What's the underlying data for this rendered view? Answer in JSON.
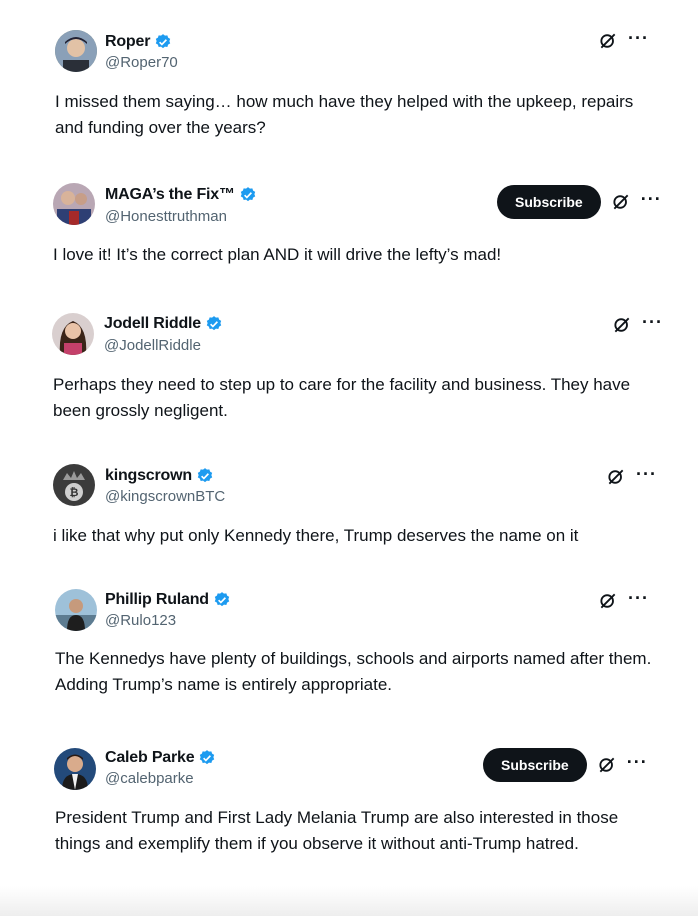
{
  "posts": [
    {
      "name": "Roper",
      "handle": "@Roper70",
      "text": "I missed them saying… how much have they helped with the upkeep, repairs and funding over the years?",
      "subscribe": null
    },
    {
      "name": "MAGA’s the Fix™",
      "handle": "@Honesttruthman",
      "text": "I love it!  It’s the correct plan AND it will drive the lefty’s mad!",
      "subscribe": "Subscribe"
    },
    {
      "name": "Jodell Riddle",
      "handle": "@JodellRiddle",
      "text": "Perhaps they need to step up to care for the facility and business. They have been grossly negligent.",
      "subscribe": null
    },
    {
      "name": "kingscrown",
      "handle": "@kingscrownBTC",
      "text": "i like that why put only Kennedy there, Trump deserves the name on it",
      "subscribe": null
    },
    {
      "name": "Phillip Ruland",
      "handle": "@Rulo123",
      "text": "The Kennedys have plenty of buildings, schools and airports named after them. Adding Trump’s name is entirely appropriate.",
      "subscribe": null
    },
    {
      "name": "Caleb Parke",
      "handle": "@calebparke",
      "text": "President Trump and First Lady Melania Trump are also interested in those things and exemplify them if you observe it without anti-Trump hatred.",
      "subscribe": "Subscribe"
    }
  ],
  "icons": {
    "verified": "verified-badge-icon",
    "grok": "grok-icon",
    "more": "more-icon"
  },
  "colors": {
    "verified": "#1d9bf0",
    "text": "#0f1419",
    "muted": "#536471",
    "button": "#0f1419"
  }
}
